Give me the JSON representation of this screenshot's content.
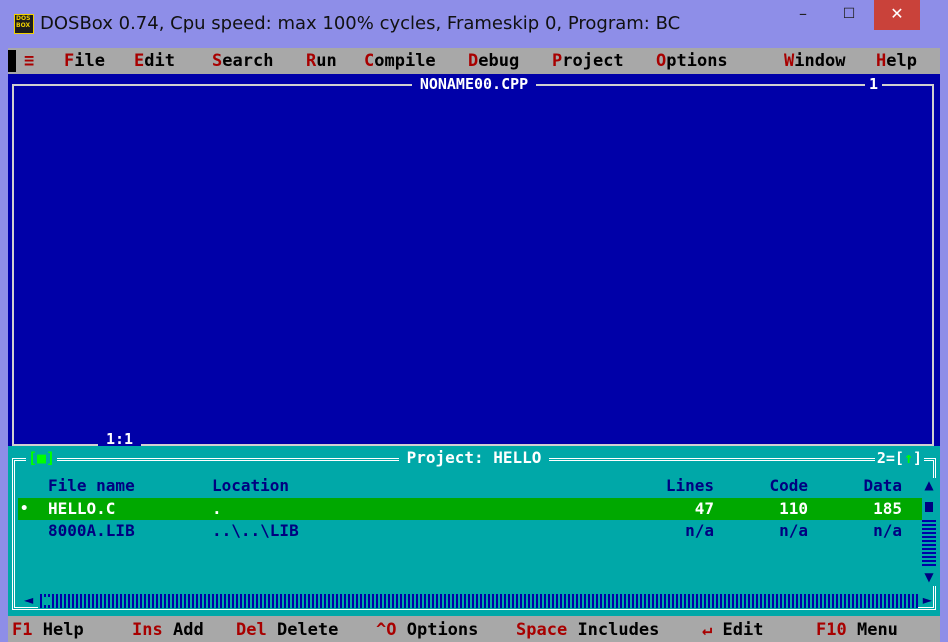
{
  "window": {
    "title": "DOSBox 0.74, Cpu speed: max 100% cycles, Frameskip  0, Program:    BC",
    "icon_text": "DOS BOX",
    "minimize_glyph": "–",
    "maximize_glyph": "☐",
    "close_glyph": "✕"
  },
  "menu": {
    "system": "≡",
    "items": [
      {
        "hot": "F",
        "rest": "ile"
      },
      {
        "hot": "E",
        "rest": "dit"
      },
      {
        "hot": "S",
        "rest": "earch"
      },
      {
        "hot": "R",
        "rest": "un"
      },
      {
        "hot": "C",
        "rest": "ompile"
      },
      {
        "hot": "D",
        "rest": "ebug"
      },
      {
        "hot": "P",
        "rest": "roject"
      },
      {
        "hot": "O",
        "rest": "ptions"
      },
      {
        "hot": "W",
        "rest": "indow"
      },
      {
        "hot": "H",
        "rest": "elp"
      }
    ]
  },
  "editor": {
    "filename": "NONAME00.CPP",
    "window_number": "1",
    "cursor_position": "1:1"
  },
  "project": {
    "title": "Project: HELLO",
    "left_control": "[■]",
    "right_number": "2=[",
    "right_arrow": "↑",
    "right_close": "]",
    "headers": {
      "file": "File name",
      "location": "Location",
      "lines": "Lines",
      "code": "Code",
      "data": "Data"
    },
    "rows": [
      {
        "bullet": "•",
        "file": "HELLO.C",
        "location": ".",
        "lines": "47",
        "code": "110",
        "data": "185",
        "selected": true
      },
      {
        "bullet": "",
        "file": "8000A.LIB",
        "location": "..\\..\\LIB",
        "lines": "n/a",
        "code": "n/a",
        "data": "n/a",
        "selected": false
      }
    ],
    "scroll_up": "▲",
    "scroll_down": "▼",
    "scroll_left": "◄",
    "scroll_right": "►"
  },
  "status": [
    {
      "key": "F1",
      "label": "Help"
    },
    {
      "key": "Ins",
      "label": "Add"
    },
    {
      "key": "Del",
      "label": "Delete"
    },
    {
      "key": "^O",
      "label": "Options"
    },
    {
      "key": "Space",
      "label": "Includes"
    },
    {
      "key": "↵",
      "label": "Edit"
    },
    {
      "key": "F10",
      "label": "Menu"
    }
  ],
  "colors": {
    "dos_blue": "#0000a8",
    "dos_cyan": "#00a8a8",
    "dos_gray": "#a8a8a8",
    "highlight_green": "#00a800",
    "hotkey_red": "#a80000"
  }
}
